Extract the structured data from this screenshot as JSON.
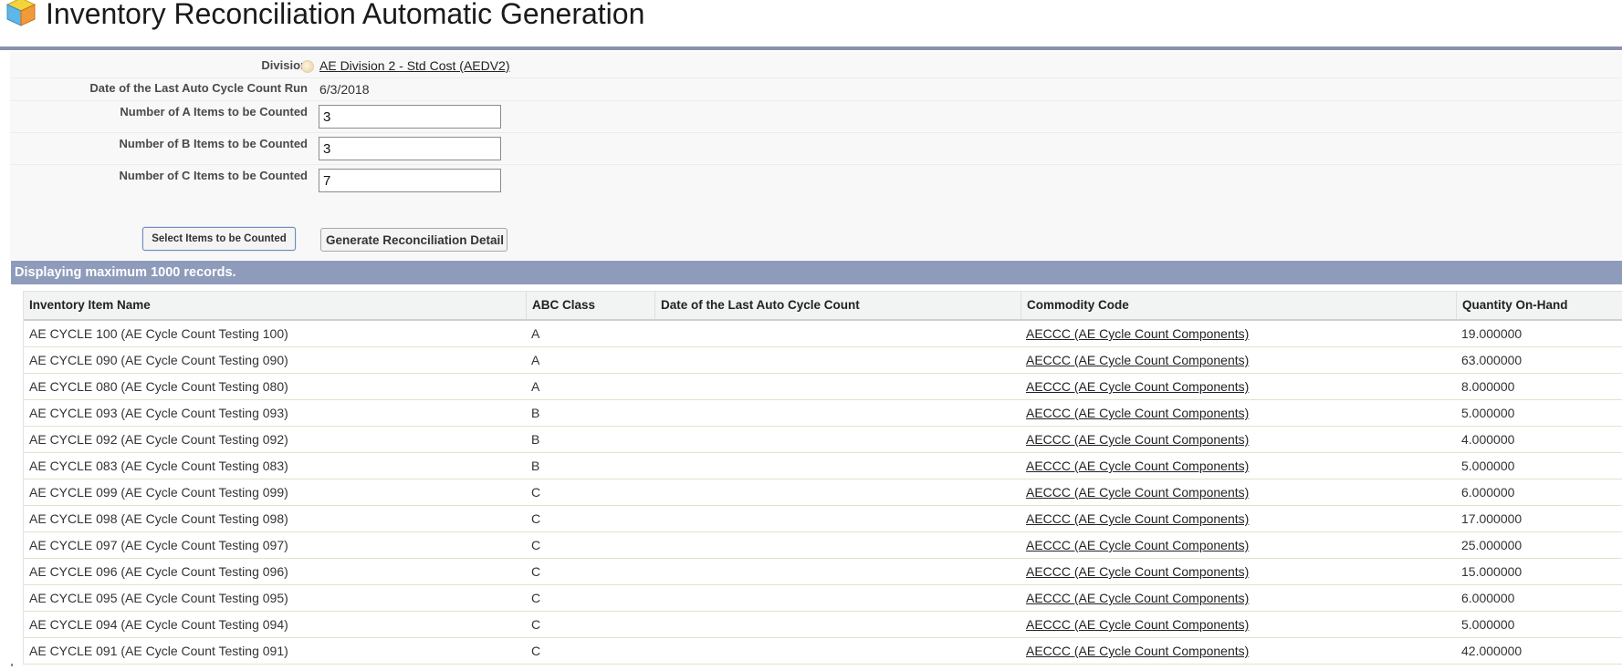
{
  "header": {
    "title": "Inventory Reconciliation Automatic Generation",
    "icon": "inventory-cube-icon"
  },
  "form": {
    "division": {
      "label": "Division",
      "value": "AE Division 2 - Std Cost (AEDV2)"
    },
    "last_run": {
      "label": "Date of the Last Auto Cycle Count Run",
      "value": "6/3/2018"
    },
    "a_items": {
      "label": "Number of A Items to be Counted",
      "value": "3"
    },
    "b_items": {
      "label": "Number of B Items to be Counted",
      "value": "3"
    },
    "c_items": {
      "label": "Number of C Items to be Counted",
      "value": "7"
    }
  },
  "buttons": {
    "select_label": "Select Items to be Counted",
    "generate_label": "Generate Reconciliation Detail"
  },
  "records_bar": "Displaying maximum 1000 records.",
  "table": {
    "columns": [
      "Inventory Item Name",
      "ABC Class",
      "Date of the Last Auto Cycle Count",
      "Commodity Code",
      "Quantity On-Hand"
    ],
    "rows": [
      {
        "name": "AE CYCLE 100 (AE Cycle Count Testing 100)",
        "abc": "A",
        "last_count": "",
        "commodity": "AECCC (AE Cycle Count Components)",
        "qty": "19.000000"
      },
      {
        "name": "AE CYCLE 090 (AE Cycle Count Testing 090)",
        "abc": "A",
        "last_count": "",
        "commodity": "AECCC (AE Cycle Count Components)",
        "qty": "63.000000"
      },
      {
        "name": "AE CYCLE 080 (AE Cycle Count Testing 080)",
        "abc": "A",
        "last_count": "",
        "commodity": "AECCC (AE Cycle Count Components)",
        "qty": "8.000000"
      },
      {
        "name": "AE CYCLE 093 (AE Cycle Count Testing 093)",
        "abc": "B",
        "last_count": "",
        "commodity": "AECCC (AE Cycle Count Components)",
        "qty": "5.000000"
      },
      {
        "name": "AE CYCLE 092 (AE Cycle Count Testing 092)",
        "abc": "B",
        "last_count": "",
        "commodity": "AECCC (AE Cycle Count Components)",
        "qty": "4.000000"
      },
      {
        "name": "AE CYCLE 083 (AE Cycle Count Testing 083)",
        "abc": "B",
        "last_count": "",
        "commodity": "AECCC (AE Cycle Count Components)",
        "qty": "5.000000"
      },
      {
        "name": "AE CYCLE 099 (AE Cycle Count Testing 099)",
        "abc": "C",
        "last_count": "",
        "commodity": "AECCC (AE Cycle Count Components)",
        "qty": "6.000000"
      },
      {
        "name": "AE CYCLE 098 (AE Cycle Count Testing 098)",
        "abc": "C",
        "last_count": "",
        "commodity": "AECCC (AE Cycle Count Components)",
        "qty": "17.000000"
      },
      {
        "name": "AE CYCLE 097 (AE Cycle Count Testing 097)",
        "abc": "C",
        "last_count": "",
        "commodity": "AECCC (AE Cycle Count Components)",
        "qty": "25.000000"
      },
      {
        "name": "AE CYCLE 096 (AE Cycle Count Testing 096)",
        "abc": "C",
        "last_count": "",
        "commodity": "AECCC (AE Cycle Count Components)",
        "qty": "15.000000"
      },
      {
        "name": "AE CYCLE 095 (AE Cycle Count Testing 095)",
        "abc": "C",
        "last_count": "",
        "commodity": "AECCC (AE Cycle Count Components)",
        "qty": "6.000000"
      },
      {
        "name": "AE CYCLE 094 (AE Cycle Count Testing 094)",
        "abc": "C",
        "last_count": "",
        "commodity": "AECCC (AE Cycle Count Components)",
        "qty": "5.000000"
      },
      {
        "name": "AE CYCLE 091 (AE Cycle Count Testing 091)",
        "abc": "C",
        "last_count": "",
        "commodity": "AECCC (AE Cycle Count Components)",
        "qty": "42.000000"
      }
    ]
  },
  "colors": {
    "header_rule": "#8a91ae",
    "records_bar": "#8e9bbb",
    "form_background": "#f8f8f8"
  }
}
